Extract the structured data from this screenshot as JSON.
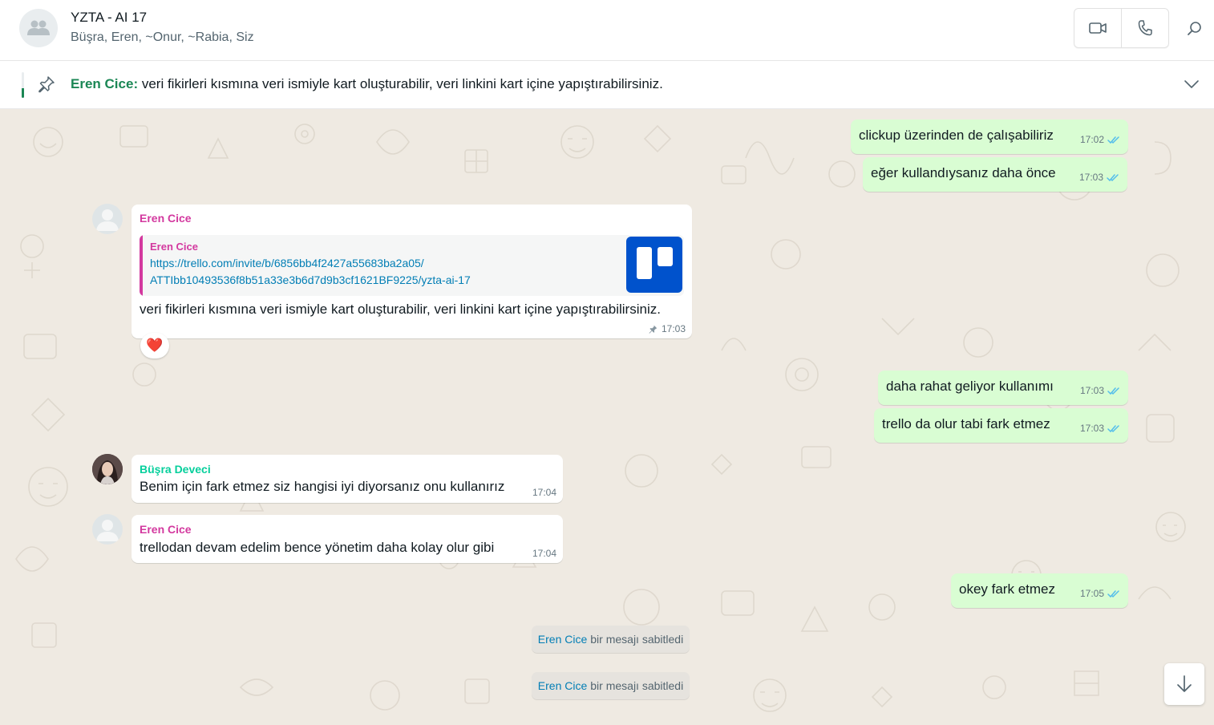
{
  "header": {
    "title": "YZTA - AI 17",
    "members": "Büşra, Eren, ~Onur, ~Rabia, Siz",
    "avatar_icon": "group-icon",
    "video_icon": "video-camera-icon",
    "call_icon": "phone-icon",
    "search_icon": "search-icon"
  },
  "pinned": {
    "sender": "Eren Cice",
    "separator": ":",
    "text": "veri fikirleri kısmına veri ismiyle kart oluşturabilir, veri linkini kart içine yapıştırabilirsiniz.",
    "accent": "#1b8755"
  },
  "messages": {
    "out1": {
      "text": "clickup üzerinden de çalışabiliriz",
      "time": "17:02"
    },
    "out2": {
      "text": "eğer kullandıysanız daha önce",
      "time": "17:03"
    },
    "in1": {
      "sender": "Eren Cice",
      "quote_sender": "Eren Cice",
      "quote_line1": "https://trello.com/invite/b/6856bb4f2427a55683ba2a05/",
      "quote_line2": "ATTIbb10493536f8b51a33e3b6d7d9b3cf1621BF9225/yzta-ai-17",
      "text": "veri fikirleri kısmına veri ismiyle kart oluşturabilir, veri linkini kart içine yapıştırabilirsiniz.",
      "time": "17:03",
      "reaction": "❤️"
    },
    "out3": {
      "text": "daha rahat geliyor kullanımı",
      "time": "17:03"
    },
    "out4": {
      "text": "trello da olur tabi fark etmez",
      "time": "17:03"
    },
    "in2": {
      "sender": "Büşra Deveci",
      "text": "Benim için fark etmez siz hangisi iyi diyorsanız onu kullanırız",
      "time": "17:04"
    },
    "in3": {
      "sender": "Eren Cice",
      "text": "trellodan devam edelim bence yönetim daha kolay olur gibi",
      "time": "17:04"
    },
    "out5": {
      "text": "okey fark etmez",
      "time": "17:05"
    }
  },
  "system": [
    {
      "name": "Eren Cice",
      "text": "bir mesajı sabitledi"
    },
    {
      "name": "Eren Cice",
      "text": "bir mesajı sabitledi"
    }
  ],
  "colors": {
    "outgoing_bubble": "#d9fdd3",
    "incoming_bubble": "#ffffff",
    "chat_background": "#efeae2",
    "sender_pink": "#d3399f",
    "sender_teal": "#06cf9c",
    "read_tick": "#53bdeb",
    "trello_blue": "#0052cc"
  }
}
